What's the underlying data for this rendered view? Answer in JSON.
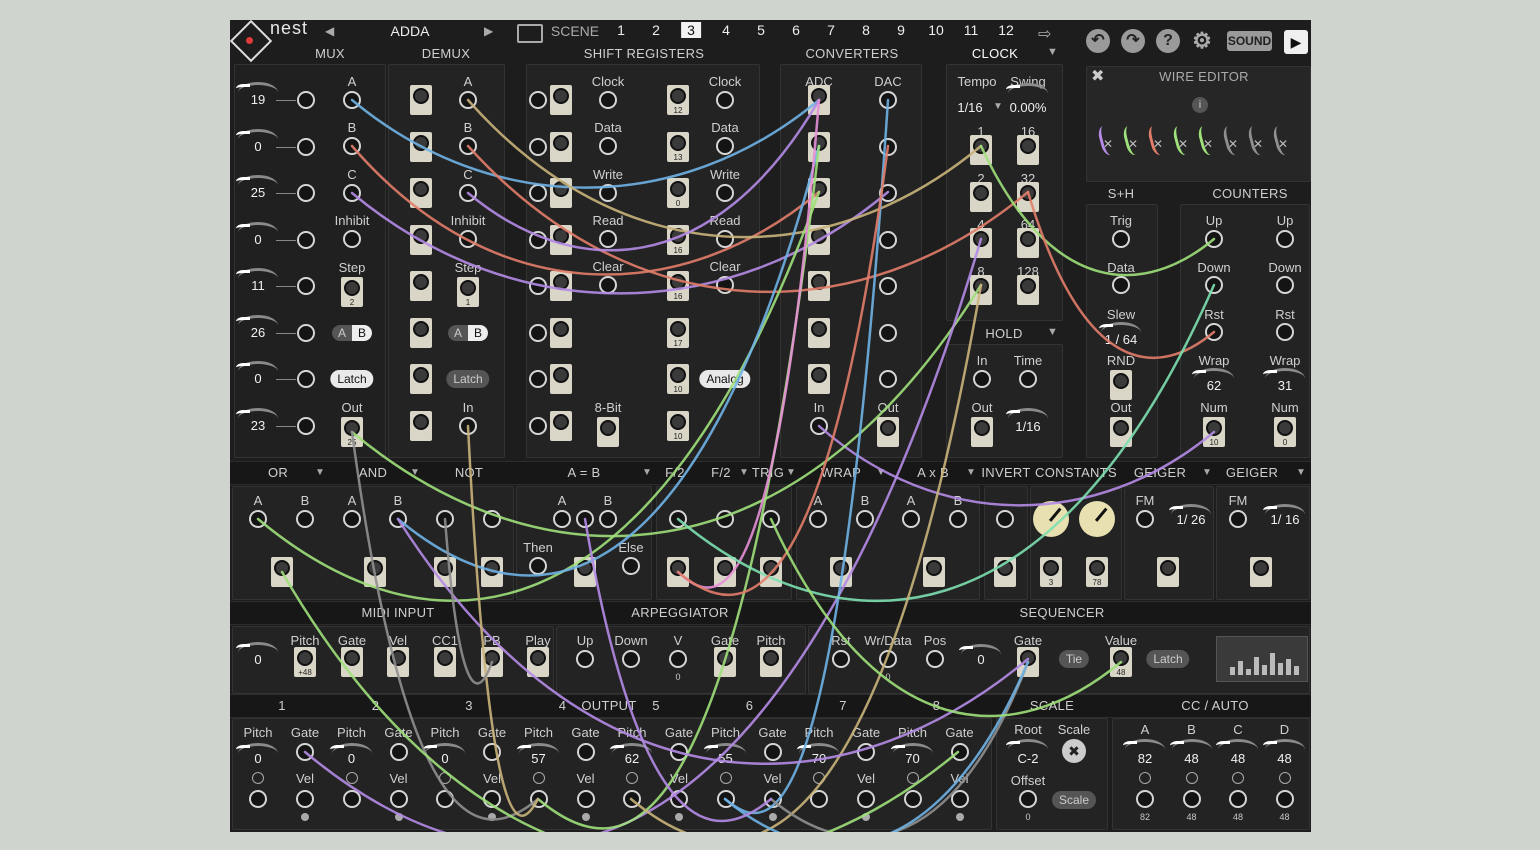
{
  "toolbar": {
    "logo_text": "nest",
    "preset_name": "ADDA",
    "scene_label": "SCENE",
    "scenes": [
      "1",
      "2",
      "3",
      "4",
      "5",
      "6",
      "7",
      "8",
      "9",
      "10",
      "11",
      "12"
    ],
    "selected_scene": "3",
    "sound_label": "SOUND"
  },
  "mux": {
    "title": "MUX",
    "values": [
      "19",
      "0",
      "25",
      "0",
      "11",
      "26",
      "0",
      "23"
    ],
    "labels": {
      "a": "A",
      "b": "B",
      "c": "C",
      "inhibit": "Inhibit",
      "step": "Step",
      "a_btn": "A",
      "b_btn": "B",
      "latch": "Latch",
      "out": "Out"
    },
    "step_val": "2",
    "out_val": "25"
  },
  "demux": {
    "title": "DEMUX",
    "labels": {
      "a": "A",
      "b": "B",
      "c": "C",
      "inhibit": "Inhibit",
      "step": "Step",
      "latch": "Latch",
      "in": "In"
    },
    "step_val": "1"
  },
  "shift": {
    "title": "SHIFT REGISTERS",
    "clock": "Clock",
    "data": "Data",
    "write": "Write",
    "read": "Read",
    "clear": "Clear",
    "bit8": "8-Bit",
    "analog": "Analog",
    "vals1": [
      "12",
      "13",
      "0",
      "16",
      "16",
      "17",
      "10",
      "10"
    ]
  },
  "converters": {
    "title": "CONVERTERS",
    "adc": "ADC",
    "dac": "DAC",
    "in": "In",
    "out": "Out"
  },
  "clock": {
    "title": "CLOCK",
    "tempo": "Tempo",
    "swing": "Swing",
    "tempo_val": "1/16",
    "swing_val": "0.00%",
    "divs": [
      "1",
      "16",
      "2",
      "32",
      "4",
      "64",
      "8",
      "128"
    ]
  },
  "hold": {
    "title": "HOLD",
    "in": "In",
    "time": "Time",
    "out": "Out",
    "time_val": "1/16"
  },
  "wire_editor": {
    "title": "WIRE EDITOR"
  },
  "sh": {
    "title": "S+H",
    "trig": "Trig",
    "data": "Data",
    "slew": "Slew",
    "slew_val": "1 / 64",
    "rnd": "RND",
    "out": "Out"
  },
  "counters": {
    "title": "COUNTERS",
    "up": "Up",
    "down": "Down",
    "rst": "Rst",
    "wrap": "Wrap",
    "num": "Num",
    "wrap1": "62",
    "wrap2": "31",
    "num1": "10",
    "num2": "0"
  },
  "row2": {
    "or": "OR",
    "and": "AND",
    "not": "NOT",
    "aeqb": "A = B",
    "f2a": "F/2",
    "f2b": "F/2",
    "trig": "TRIG",
    "wrap": "WRAP",
    "axb": "A x B",
    "invert": "INVERT",
    "constants": "CONSTANTS",
    "geiger1": "GEIGER",
    "geiger2": "GEIGER",
    "a": "A",
    "b": "B",
    "then": "Then",
    "else": "Else",
    "fm": "FM",
    "geiger1_val": "1/ 26",
    "geiger2_val": "1/ 16",
    "const1": "3",
    "const2": "78"
  },
  "row3": {
    "midi": "MIDI INPUT",
    "arp": "ARPEGGIATOR",
    "seq": "SEQUENCER",
    "midi_val": "0",
    "pitch": "Pitch",
    "gate": "Gate",
    "vel": "Vel",
    "cc1": "CC1",
    "pb": "PB",
    "play": "Play",
    "up": "Up",
    "down": "Down",
    "v": "V",
    "rst": "Rst",
    "wrdata": "Wr/Data",
    "pos": "Pos",
    "value": "Value",
    "tie": "Tie",
    "latch": "Latch",
    "pitch_val": "+48",
    "seq_pos": "0",
    "value_val": "48",
    "wr_val": "0",
    "v_val": "0"
  },
  "output": {
    "title": "OUTPUT",
    "channels": [
      "1",
      "2",
      "3",
      "4",
      "5",
      "6",
      "7",
      "8"
    ],
    "pitch_vals": [
      "0",
      "0",
      "0",
      "57",
      "62",
      "55",
      "70",
      "70"
    ],
    "pitch": "Pitch",
    "gate": "Gate",
    "vel": "Vel"
  },
  "scale": {
    "title": "SCALE",
    "root": "Root",
    "scale": "Scale",
    "root_val": "C-2",
    "offset": "Offset",
    "scale_btn": "Scale",
    "offset_val": "0"
  },
  "cc": {
    "title": "CC / AUTO",
    "labels": [
      "A",
      "B",
      "C",
      "D"
    ],
    "vals": [
      "82",
      "48",
      "48",
      "48"
    ]
  },
  "colors": {
    "wire_blue": "#6fb3e6",
    "wire_green": "#9fe07a",
    "wire_purple": "#b58be6",
    "wire_red": "#e27d6a",
    "wire_tan": "#c9b47a",
    "wire_gray": "#8f8f8f",
    "wire_mint": "#7de0b0",
    "wire_pink": "#e58fd6"
  }
}
